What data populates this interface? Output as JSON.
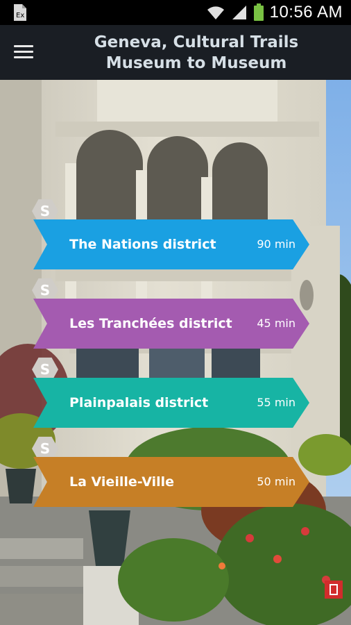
{
  "status_bar": {
    "time": "10:56 AM",
    "icons": [
      "notification-icon",
      "wifi-icon",
      "signal-icon",
      "battery-icon"
    ]
  },
  "app_bar": {
    "title_line1": "Geneva, Cultural Trails",
    "title_line2": "Museum to Museum",
    "menu_icon": "hamburger-menu-icon"
  },
  "trails": [
    {
      "name": "The Nations district",
      "duration": "90 min",
      "tag": "S",
      "color": "#1aa0e2"
    },
    {
      "name": "Les Tranchées district",
      "duration": "45 min",
      "tag": "S",
      "color": "#a45bb0"
    },
    {
      "name": "Plainpalais district",
      "duration": "55 min",
      "tag": "S",
      "color": "#17b4a4"
    },
    {
      "name": "La Vieille-Ville",
      "duration": "50 min",
      "tag": "S",
      "color": "#c67f26"
    }
  ],
  "colors": {
    "status_bar_bg": "#000000",
    "app_bar_bg": "#1a1e24",
    "title_color": "#d6dfe6"
  }
}
